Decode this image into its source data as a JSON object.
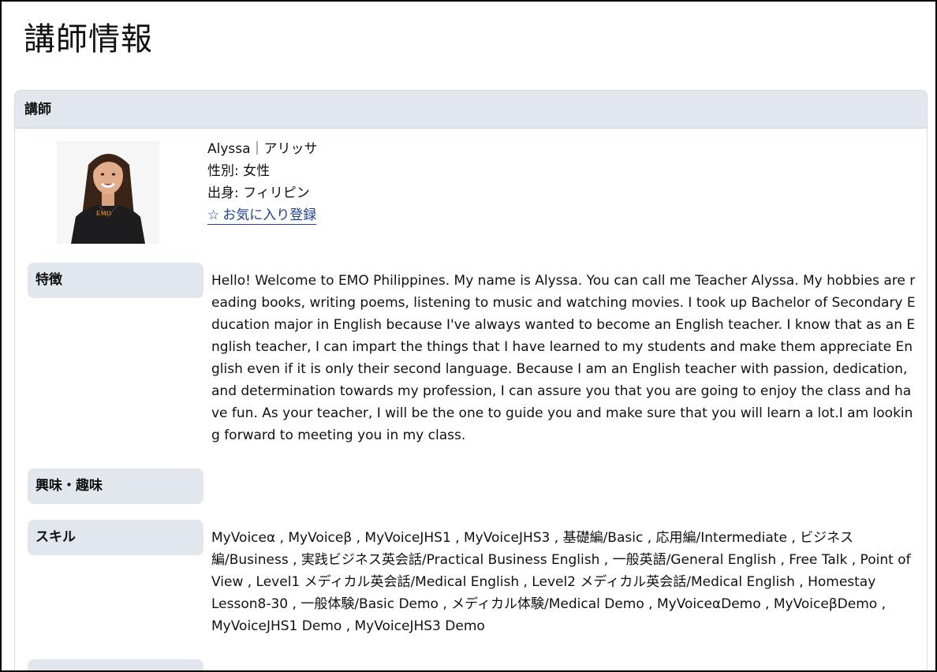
{
  "page": {
    "title": "講師情報"
  },
  "card": {
    "header": "講師"
  },
  "teacher": {
    "name": "Alyssa｜アリッサ",
    "gender": "性別: 女性",
    "origin": "出身: フィリピン",
    "favorite_label": "お気に入り登録",
    "favorite_icon": "star-outline-icon",
    "shirt_logo_text": "EMO"
  },
  "sections": [
    {
      "label": "特徴",
      "value": "Hello! Welcome to EMO Philippines. My name is Alyssa. You can call me Teacher Alyssa. My hobbies are reading books, writing poems, listening to music and watching movies. I took up Bachelor of Secondary Education major in English because I've always wanted to become an English teacher. I know that as an English teacher, I can impart the things that I have learned to my students and make them appreciate English even if it is only their second language. Because I am an English teacher with passion, dedication, and determination towards my profession, I can assure you that you are going to enjoy the class and have fun. As your teacher, I will be the one to guide you and make sure that you will learn a lot.I am looking forward to meeting you in my class."
    },
    {
      "label": "興味・趣味",
      "value": ""
    },
    {
      "label": "スキル",
      "value": "MyVoiceα , MyVoiceβ , MyVoiceJHS1 , MyVoiceJHS3 , 基礎編/Basic , 応用編/Intermediate , ビジネス編/Business , 実践ビジネス英会話/Practical Business English , 一般英語/General English , Free Talk , Point of View , Level1 メディカル英会話/Medical English , Level2 メディカル英会話/Medical English , Homestay Lesson8-30 , 一般体験/Basic Demo , メディカル体験/Medical Demo , MyVoiceαDemo , MyVoiceβDemo , MyVoiceJHS1 Demo , MyVoiceJHS3 Demo"
    }
  ],
  "colors": {
    "header_bg": "#e2e7ee",
    "label_bg": "#e2e7ee",
    "link": "#1f3f9c",
    "text": "#111111"
  }
}
